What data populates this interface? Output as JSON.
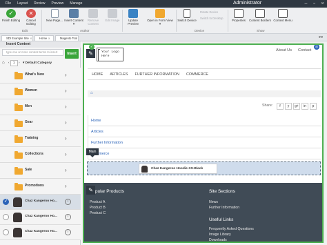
{
  "topbar": {
    "menu": [
      "File",
      "Layout",
      "Review",
      "Preview",
      "Manage"
    ],
    "user": "Administrator",
    "window_buttons": [
      "minimize-icon",
      "restore-icon",
      "close-icon"
    ]
  },
  "ribbon": {
    "buttons": {
      "finish_editing": "Finish Editing",
      "cancel_editing": "Cancel Editing",
      "new_page": "New Page...",
      "insert_content": "Insert Content ▾",
      "remove_content": "Remove Content",
      "edit_image": "Edit Image",
      "update_preview": "Update Preview",
      "open_form_view": "Open in Form View ▾",
      "switch_device": "Switch Device",
      "rotate_device": "Rotate Device",
      "switch_desktop": "Switch to Desktop",
      "properties": "Properties",
      "content_borders": "Content Borders",
      "context_menu": "Context Menu"
    },
    "groups": {
      "edit": "Edit",
      "author": "Author",
      "device": "Device",
      "show": "Show"
    }
  },
  "tabs": [
    {
      "icon": "site-icon",
      "label": "SDI Example Site"
    },
    {
      "icon": "page-icon",
      "label": "Home"
    },
    {
      "icon": "tool-icon",
      "label": "Magento Tool"
    }
  ],
  "tab_close": "x",
  "left_panel": {
    "title": "Insert Content",
    "search_placeholder": "type one or more content terms to insert",
    "insert_button": "Insert",
    "pager": {
      "page": "1",
      "category": "Default Category"
    },
    "categories": [
      "What's New",
      "Women",
      "Men",
      "Gear",
      "Training",
      "Collections",
      "Sale",
      "Promotions"
    ],
    "products": [
      {
        "label": "Chaz Kangeroo Ho...",
        "selected": true
      },
      {
        "label": "Chaz Kangeroo Ho...",
        "selected": false
      },
      {
        "label": "Chaz Kangeroo Ho...",
        "selected": false
      }
    ]
  },
  "page": {
    "logo_line1": "Your Logo",
    "logo_line2": "Here",
    "top_links": [
      "About Us",
      "Contact"
    ],
    "nav": [
      "HOME",
      "ARTICLES",
      "FURTHER INFORMATION",
      "COMMERCE"
    ],
    "share_label": "Share:",
    "share_icons": [
      "f",
      "y",
      "g+",
      "in",
      "p"
    ],
    "side_nav": [
      "Home",
      "Articles",
      "Further Information",
      "Commerce"
    ],
    "main_tag": "Main",
    "inserted_product": "Chaz Kangeroo Hoodie-XS-Black",
    "footer": {
      "popular_title": "Popular Products",
      "popular_links": [
        "Product A",
        "Product B",
        "Product C"
      ],
      "sections_title": "Site Sections",
      "sections_links": [
        "News",
        "Further Information"
      ],
      "useful_title": "Useful Links",
      "useful_links": [
        "Frequently Asked Questions",
        "Image Library",
        "Downloads"
      ]
    }
  },
  "colors": {
    "topbar": "#2f3842",
    "insert_green": "#3ba53b",
    "selection_green": "#4caf50",
    "accent_blue": "#2a63b8",
    "folder": "#f0a830",
    "footer": "#404b56"
  }
}
